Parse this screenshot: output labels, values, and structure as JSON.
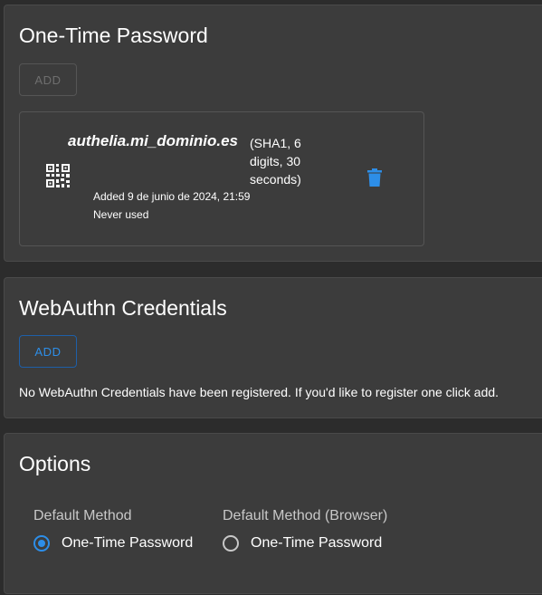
{
  "otp": {
    "title": "One-Time Password",
    "add_label": "ADD",
    "credential": {
      "name": "authelia.mi_dominio.es",
      "params": "(SHA1, 6 digits, 30 seconds)",
      "added": "Added 9 de junio de 2024, 21:59",
      "last_used": "Never used",
      "icon": "qr-code-icon",
      "delete_icon": "trash-icon"
    }
  },
  "webauthn": {
    "title": "WebAuthn Credentials",
    "add_label": "ADD",
    "empty_message": "No WebAuthn Credentials have been registered. If you'd like to register one click add."
  },
  "options": {
    "title": "Options",
    "default_method": {
      "legend": "Default Method",
      "option_label": "One-Time Password",
      "checked": true
    },
    "default_method_browser": {
      "legend": "Default Method (Browser)",
      "option_label": "One-Time Password",
      "checked": false
    }
  },
  "colors": {
    "accent": "#2d8ee8",
    "panel_bg": "#3c3c3c",
    "page_bg": "#2c2c2c"
  }
}
